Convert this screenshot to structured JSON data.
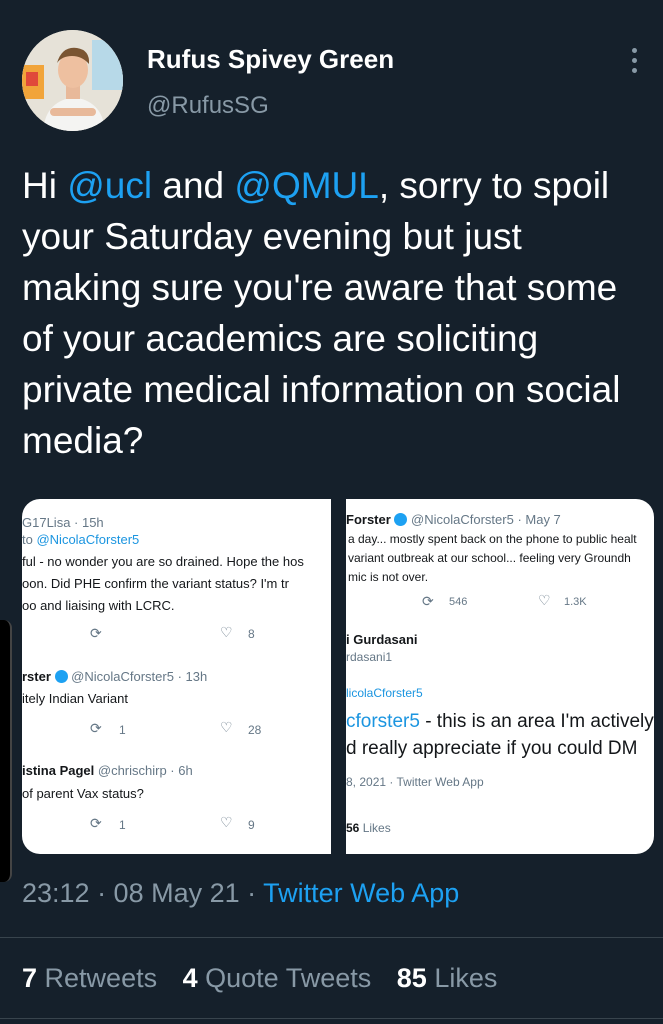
{
  "author": {
    "name": "Rufus Spivey Green",
    "handle": "@RufusSG"
  },
  "tweet": {
    "p1": "Hi ",
    "m1": "@ucl",
    "p2": " and ",
    "m2": "@QMUL",
    "p3": ", sorry to spoil your Saturday evening but just making sure you're aware that some of your academics are soliciting private medical information on social media?"
  },
  "media_left": {
    "t1_head": "G17Lisa · 15h",
    "t1_replyto_pre": "to ",
    "t1_replyto": "@NicolaCforster5",
    "t1_line1": "ful - no wonder you are so drained. Hope the hos",
    "t1_line2": "oon.      Did PHE confirm the variant status? I'm tr",
    "t1_line3": "oo and liaising with LCRC.",
    "t1_like": "8",
    "t2_name": "rster",
    "t2_handle": "@NicolaCforster5 · 13h",
    "t2_line1": "itely Indian Variant",
    "t2_rt": "1",
    "t2_like": "28",
    "t3_name": "istina Pagel",
    "t3_handle": "@chrischirp · 6h",
    "t3_line1": "of parent Vax status?",
    "t3_rt": "1",
    "t3_like": "9"
  },
  "media_right": {
    "t1_name": "Forster",
    "t1_handle": "@NicolaCforster5 · May 7",
    "t1_line1": "a day... mostly spent back on the phone to public healt",
    "t1_line2": "variant outbreak at our school... feeling very Groundh",
    "t1_line3": "mic is not over.",
    "t1_rt": "546",
    "t1_like": "1.3K",
    "t2_name": "i Gurdasani",
    "t2_handle": "rdasani1",
    "t2_replyto": "licolaCforster5",
    "t2_big1_mention": "cforster5",
    "t2_big1_rest": " - this is an area I'm actively",
    "t2_big2": "d really appreciate if you could DM",
    "t2_meta": "8, 2021 · Twitter Web App",
    "t2_likes_num": "56",
    "t2_likes_label": " Likes"
  },
  "timestamp": {
    "time": "23:12 · 08 May 21 · ",
    "app": "Twitter Web App"
  },
  "stats": {
    "retweets": "7",
    "retweets_label": " Retweets",
    "quotes": "4",
    "quotes_label": " Quote Tweets",
    "likes": "85",
    "likes_label": " Likes"
  },
  "colors": {
    "background": "#15202b",
    "accent": "#1da1f2",
    "secondary_text": "#8899a6"
  }
}
